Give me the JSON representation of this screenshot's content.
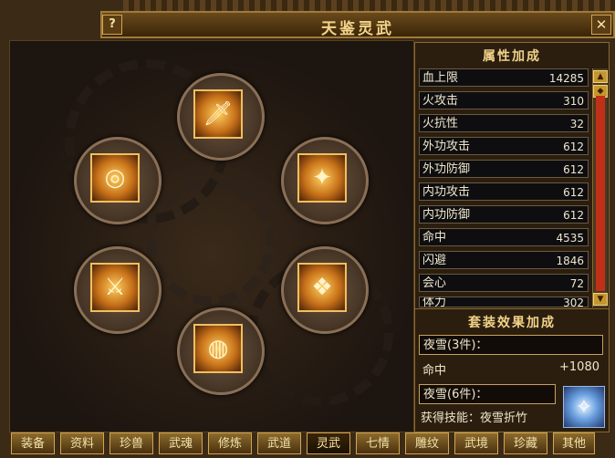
{
  "window": {
    "title": "天鉴灵武",
    "help_label": "?",
    "close_label": "✕"
  },
  "equip_slots": [
    {
      "name": "spear",
      "glyph": "🗡"
    },
    {
      "name": "ring",
      "glyph": "◎"
    },
    {
      "name": "armor",
      "glyph": "✦"
    },
    {
      "name": "dagger",
      "glyph": "⚔"
    },
    {
      "name": "charm",
      "glyph": "❖"
    },
    {
      "name": "belt",
      "glyph": "◍"
    }
  ],
  "stats": {
    "title": "属性加成",
    "items": [
      {
        "label": "血上限",
        "value": "14285"
      },
      {
        "label": "火攻击",
        "value": "310"
      },
      {
        "label": "火抗性",
        "value": "32"
      },
      {
        "label": "外功攻击",
        "value": "612"
      },
      {
        "label": "外功防御",
        "value": "612"
      },
      {
        "label": "内功攻击",
        "value": "612"
      },
      {
        "label": "内功防御",
        "value": "612"
      },
      {
        "label": "命中",
        "value": "4535"
      },
      {
        "label": "闪避",
        "value": "1846"
      },
      {
        "label": "会心",
        "value": "72"
      },
      {
        "label": "体力",
        "value": "302"
      }
    ],
    "scroll_up": "▲",
    "scroll_down": "▼"
  },
  "set_bonus": {
    "title": "套装效果加成",
    "set3_label": "夜雪(3件)：",
    "set3_stat_label": "命中",
    "set3_stat_value": "+1080",
    "set6_label": "夜雪(6件)：",
    "set6_skill": "获得技能：夜雪折竹",
    "skill_icon": "✧"
  },
  "tabs": [
    "装备",
    "资料",
    "珍兽",
    "武魂",
    "修炼",
    "武道",
    "灵武",
    "七情",
    "雕纹",
    "武境",
    "珍藏",
    "其他"
  ],
  "active_tab": "灵武"
}
